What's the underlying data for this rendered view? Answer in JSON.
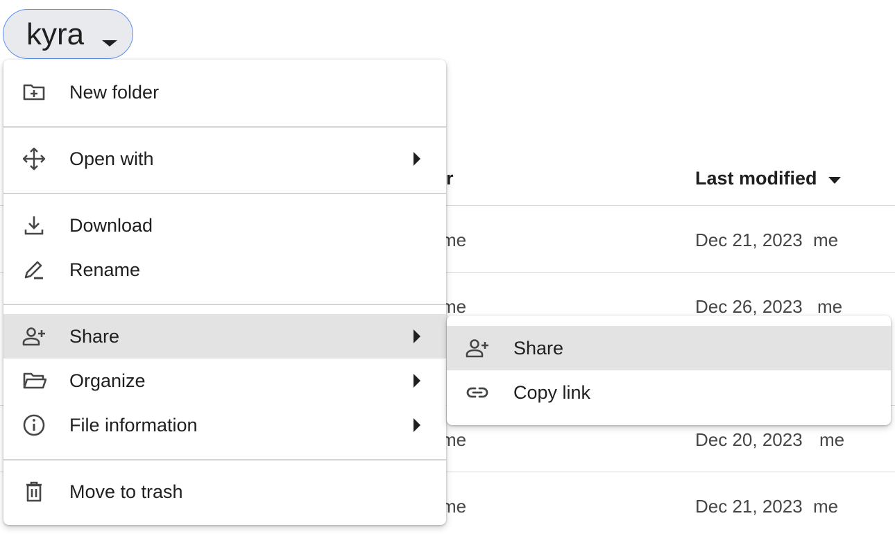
{
  "folder_chip": {
    "label": "kyra",
    "icon": "chevron-down-icon"
  },
  "list": {
    "headers": {
      "owner_partial": "er",
      "last_modified": "Last modified"
    },
    "rows": [
      {
        "owner": "me",
        "modified": "Dec 21, 2023",
        "modified_by": "me"
      },
      {
        "owner": "me",
        "modified": "Dec 26, 2023",
        "modified_by": "me"
      },
      {
        "owner": "me",
        "modified": "Dec 20, 2023",
        "modified_by": "me"
      },
      {
        "owner": "me",
        "modified": "Dec 21, 2023",
        "modified_by": "me"
      }
    ]
  },
  "menu": {
    "items": [
      {
        "label": "New folder",
        "icon": "new-folder-icon"
      },
      {
        "label": "Open with",
        "icon": "open-with-icon",
        "submenu": true
      },
      {
        "label": "Download",
        "icon": "download-icon"
      },
      {
        "label": "Rename",
        "icon": "rename-icon"
      },
      {
        "label": "Share",
        "icon": "person-add-icon",
        "submenu": true,
        "active": true
      },
      {
        "label": "Organize",
        "icon": "folder-open-icon",
        "submenu": true
      },
      {
        "label": "File information",
        "icon": "info-icon",
        "submenu": true
      },
      {
        "label": "Move to trash",
        "icon": "trash-icon"
      }
    ]
  },
  "submenu": {
    "items": [
      {
        "label": "Share",
        "icon": "person-add-icon",
        "active": true
      },
      {
        "label": "Copy link",
        "icon": "link-icon"
      }
    ]
  },
  "colors": {
    "chip_border": "#5b8def",
    "chip_bg": "#e9eaee",
    "active_bg": "#e3e3e3",
    "text": "#1f1f1f"
  }
}
